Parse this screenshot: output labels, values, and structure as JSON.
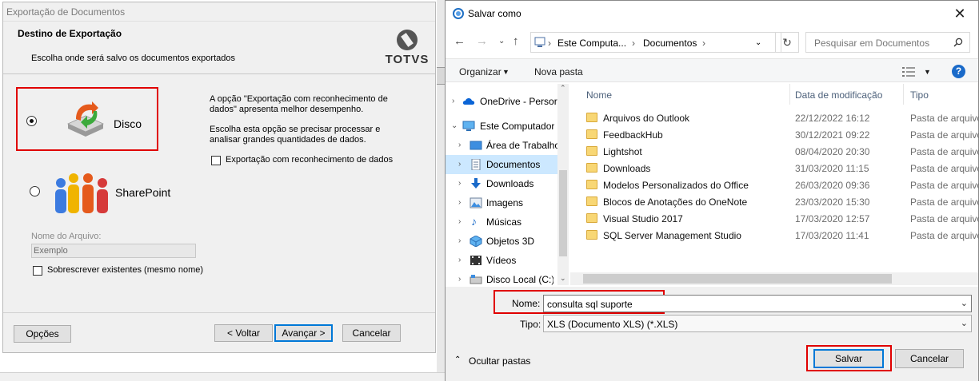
{
  "export_dialog": {
    "title": "Exportação de Documentos",
    "header_title": "Destino de Exportação",
    "header_subtitle": "Escolha onde será salvo os documentos exportados",
    "logo_text": "TOTVS",
    "option_disk_label": "Disco",
    "option_sharepoint_label": "SharePoint",
    "selected_option": "Disco",
    "info_paragraph_1": [
      "A opção \"Exportação com reconhecimento de",
      "dados\" apresenta melhor desempenho."
    ],
    "info_paragraph_2": [
      "Escolha esta opção se precisar processar e",
      "analisar grandes quantidades de dados."
    ],
    "data_recognition_checkbox_label": "Exportação com reconhecimento de dados",
    "data_recognition_checked": false,
    "filename_label": "Nome do Arquivo:",
    "filename_value": "Exemplo",
    "overwrite_checkbox_label": "Sobrescrever existentes (mesmo nome)",
    "overwrite_checked": false,
    "buttons": {
      "options": "Opções",
      "back": "< Voltar",
      "next": "Avançar >",
      "cancel": "Cancelar"
    }
  },
  "save_dialog": {
    "title": "Salvar como",
    "address": [
      "Este Computa...",
      "Documentos"
    ],
    "search_placeholder": "Pesquisar em Documentos",
    "toolbar": {
      "organize": "Organizar",
      "new_folder": "Nova pasta"
    },
    "tree": [
      {
        "label": "OneDrive - Persor",
        "icon": "cloud-icon",
        "selected": false,
        "level": 0
      },
      {
        "label": "Este Computador",
        "icon": "computer-icon",
        "selected": false,
        "level": 0,
        "expanded": true
      },
      {
        "label": "Área de Trabalho",
        "icon": "desktop-icon",
        "selected": false,
        "level": 1
      },
      {
        "label": "Documentos",
        "icon": "documents-icon",
        "selected": true,
        "level": 1
      },
      {
        "label": "Downloads",
        "icon": "download-icon",
        "selected": false,
        "level": 1
      },
      {
        "label": "Imagens",
        "icon": "images-icon",
        "selected": false,
        "level": 1
      },
      {
        "label": "Músicas",
        "icon": "music-icon",
        "selected": false,
        "level": 1
      },
      {
        "label": "Objetos 3D",
        "icon": "cube-icon",
        "selected": false,
        "level": 1
      },
      {
        "label": "Vídeos",
        "icon": "video-icon",
        "selected": false,
        "level": 1
      },
      {
        "label": "Disco Local (C:)",
        "icon": "drive-icon",
        "selected": false,
        "level": 1
      }
    ],
    "columns": {
      "name": "Nome",
      "modified": "Data de modificação",
      "type": "Tipo"
    },
    "files": [
      {
        "name": "Arquivos do Outlook",
        "modified": "22/12/2022 16:12",
        "type": "Pasta de arquivos"
      },
      {
        "name": "FeedbackHub",
        "modified": "30/12/2021 09:22",
        "type": "Pasta de arquivos"
      },
      {
        "name": "Lightshot",
        "modified": "08/04/2020 20:30",
        "type": "Pasta de arquivos"
      },
      {
        "name": "Downloads",
        "modified": "31/03/2020 11:15",
        "type": "Pasta de arquivos"
      },
      {
        "name": "Modelos Personalizados do Office",
        "modified": "26/03/2020 09:36",
        "type": "Pasta de arquivos"
      },
      {
        "name": "Blocos de Anotações do OneNote",
        "modified": "23/03/2020 15:30",
        "type": "Pasta de arquivos"
      },
      {
        "name": "Visual Studio 2017",
        "modified": "17/03/2020 12:57",
        "type": "Pasta de arquivos"
      },
      {
        "name": "SQL Server Management Studio",
        "modified": "17/03/2020 11:41",
        "type": "Pasta de arquivos"
      }
    ],
    "filename_label": "Nome:",
    "filename_value": "consulta sql suporte",
    "filetype_label": "Tipo:",
    "filetype_value": "XLS (Documento XLS) (*.XLS)",
    "hide_folders": "Ocultar pastas",
    "buttons": {
      "save": "Salvar",
      "cancel": "Cancelar"
    }
  },
  "colors": {
    "highlight_red": "#e00000",
    "selection_blue": "#cce8ff",
    "accent_blue": "#0078d7",
    "folder_yellow": "#f8d775"
  }
}
